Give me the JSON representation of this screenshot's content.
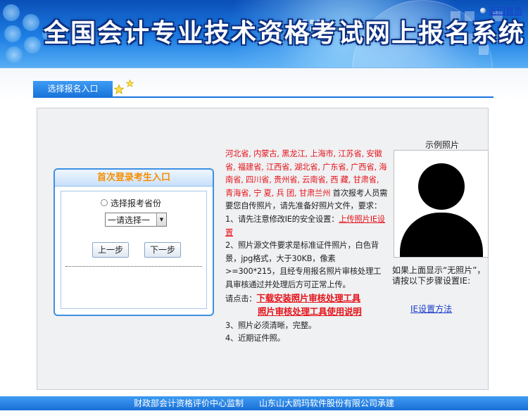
{
  "header": {
    "title": "全国会计专业技术资格考试网上报名系统",
    "home_link": "返回首页"
  },
  "tab": {
    "label": "选择报名入口"
  },
  "login": {
    "heading": "首次登录考生入口",
    "radio_label": "选择报考省份",
    "select_value": "一请选择一",
    "prev_button": "上一步",
    "next_button": "下一步"
  },
  "notes": {
    "provinces": "河北省, 内蒙古, 黑龙江, 上海市, 江苏省, 安徽省, 福建省, 江西省, 湖北省, 广东省, 广西省, 海南省, 四川省, 贵州省, 云南省, 西 藏, 甘肃省, 青海省, 宁 夏, 兵 团, 甘肃兰州",
    "intro": " 首次报考人员需要您自传照片，请先准备好照片文件，要求：",
    "item1_prefix": "1、请先注意修改IE的安全设置：",
    "item1_link": "上传照片IE设置",
    "item2": "2、照片源文件要求是标准证件照片，白色背景，jpg格式，大于30KB，像素>=300*215，且经专用报名照片审核处理工具审核通过并处理后方可正常上传。",
    "click_prefix": "请点击：",
    "download_link1": "下载安装照片审核处理工具",
    "download_link2": "照片审核处理工具使用说明",
    "item3": "3、照片必须清晰，完整。",
    "item4": "4、近期证件照。"
  },
  "sample": {
    "title": "示例照片",
    "note": "如果上面显示“无照片”，请按以下步骤设置IE:",
    "ie_link": "IE设置方法"
  },
  "footer": {
    "supervisor": "财政部会计资格评价中心监制",
    "contractor": "山东山大鸥玛软件股份有限公司承建"
  },
  "colors": {
    "accent_blue": "#1a75dc",
    "link_red": "#e4141b",
    "link_blue": "#1a3cc9",
    "heading_orange": "#f08c00"
  }
}
